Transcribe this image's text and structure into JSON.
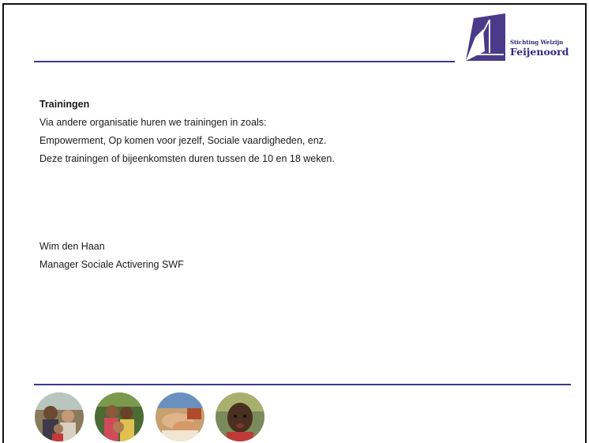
{
  "colors": {
    "rule": "#3b3a8c",
    "brand_purple": "#4a3a8a",
    "brand_blue": "#2d2a84",
    "text": "#1a1a1a"
  },
  "logo": {
    "small_text": "Stichting Welzijn",
    "big_text": "Feijenoord"
  },
  "content": {
    "heading": "Trainingen",
    "lines": [
      "Via andere organisatie huren we trainingen in zoals:",
      "Empowerment,  Op komen voor jezelf, Sociale vaardigheden,  enz.",
      "Deze trainingen of bijeenkomsten duren tussen de 10 en 18 weken."
    ]
  },
  "signature": {
    "name": "Wim den Haan",
    "role": "Manager Sociale Activering SWF"
  },
  "photos": [
    {
      "icon": "people-photo-1"
    },
    {
      "icon": "children-photo-2"
    },
    {
      "icon": "hands-photo-3"
    },
    {
      "icon": "child-portrait-photo-4"
    }
  ]
}
